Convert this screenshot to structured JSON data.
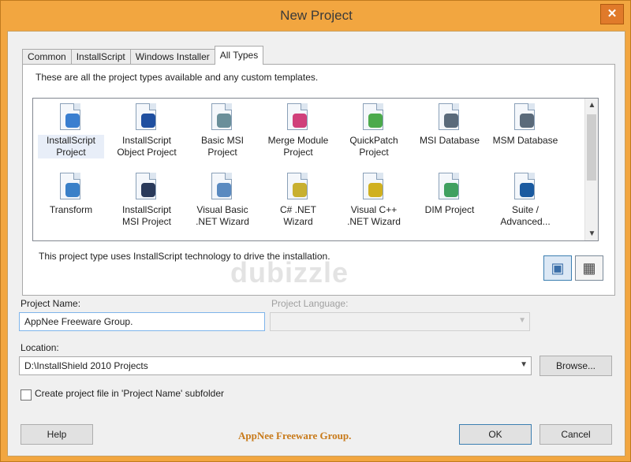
{
  "window": {
    "title": "New Project",
    "close_glyph": "✕"
  },
  "tabs": [
    {
      "label": "Common",
      "active": false
    },
    {
      "label": "InstallScript",
      "active": false
    },
    {
      "label": "Windows Installer",
      "active": false
    },
    {
      "label": "All Types",
      "active": true
    }
  ],
  "panel": {
    "description": "These are all the project types available and any custom templates.",
    "type_description": "This project type uses InstallScript technology to drive the installation."
  },
  "project_types": [
    {
      "label": "InstallScript Project",
      "icon": "installscript-project-icon",
      "color": "#3a7fd0",
      "selected": true
    },
    {
      "label": "InstallScript Object Project",
      "icon": "installscript-object-icon",
      "color": "#1f4fa0",
      "selected": false
    },
    {
      "label": "Basic MSI Project",
      "icon": "basic-msi-icon",
      "color": "#6a8f9a",
      "selected": false
    },
    {
      "label": "Merge Module Project",
      "icon": "merge-module-icon",
      "color": "#d0407a",
      "selected": false
    },
    {
      "label": "QuickPatch Project",
      "icon": "quickpatch-icon",
      "color": "#4caa4c",
      "selected": false
    },
    {
      "label": "MSI Database",
      "icon": "msi-database-icon",
      "color": "#5a6a7a",
      "selected": false
    },
    {
      "label": "MSM Database",
      "icon": "msm-database-icon",
      "color": "#5a6a7a",
      "selected": false
    },
    {
      "label": "Transform",
      "icon": "transform-icon",
      "color": "#3a80c8",
      "selected": false
    },
    {
      "label": "InstallScript MSI Project",
      "icon": "installscript-msi-icon",
      "color": "#2a3a5a",
      "selected": false
    },
    {
      "label": "Visual Basic .NET Wizard",
      "icon": "vb-net-wizard-icon",
      "color": "#5a8ac0",
      "selected": false
    },
    {
      "label": "C# .NET Wizard",
      "icon": "csharp-net-wizard-icon",
      "color": "#c8b030",
      "selected": false
    },
    {
      "label": "Visual C++ .NET Wizard",
      "icon": "cpp-net-wizard-icon",
      "color": "#d0b020",
      "selected": false
    },
    {
      "label": "DIM Project",
      "icon": "dim-project-icon",
      "color": "#40a060",
      "selected": false
    },
    {
      "label": "Suite / Advanced...",
      "icon": "suite-advanced-icon",
      "color": "#1a5aa0",
      "selected": false
    }
  ],
  "scrollbar": {
    "up_glyph": "▲",
    "down_glyph": "▼"
  },
  "view_buttons": {
    "large_icons_glyph": "▣",
    "details_glyph": "▦"
  },
  "form": {
    "project_name_label": "Project Name:",
    "project_name_value": "AppNee Freeware Group.",
    "project_language_label": "Project Language:",
    "location_label": "Location:",
    "location_value": "D:\\InstallShield 2010 Projects",
    "browse_label": "Browse...",
    "checkbox_label": "Create project file in 'Project Name' subfolder",
    "checkbox_checked": false,
    "dropdown_glyph": "▼"
  },
  "buttons": {
    "help": "Help",
    "ok": "OK",
    "cancel": "Cancel"
  },
  "branding": {
    "text": "AppNee Freeware Group.",
    "watermark": "dubizzle"
  },
  "colors": {
    "window_frame": "#f2a640",
    "selection": "#e8eef8",
    "focus_border": "#7eb4ea"
  }
}
